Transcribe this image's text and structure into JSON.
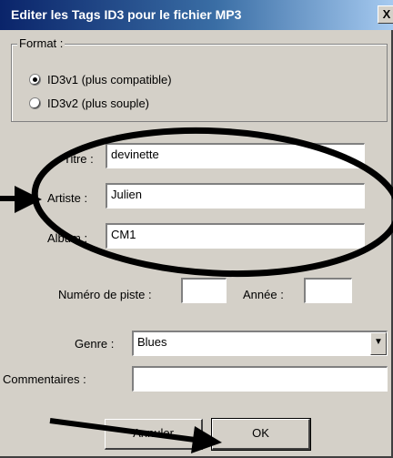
{
  "window": {
    "title": "Editer les Tags ID3 pour le fichier MP3",
    "close_glyph": "X"
  },
  "format": {
    "legend": "Format :",
    "options": [
      {
        "label": "ID3v1 (plus compatible)",
        "checked": true
      },
      {
        "label": "ID3v2 (plus souple)",
        "checked": false
      }
    ]
  },
  "fields": {
    "title": {
      "label": "Titre :",
      "value": "devinette"
    },
    "artist": {
      "label": "Artiste :",
      "value": "Julien"
    },
    "album": {
      "label": "Album :",
      "value": "CM1"
    },
    "track": {
      "label": "Numéro de piste :",
      "value": ""
    },
    "year": {
      "label": "Année :",
      "value": ""
    },
    "genre": {
      "label": "Genre :",
      "value": "Blues"
    },
    "comments": {
      "label": "Commentaires :",
      "value": ""
    }
  },
  "buttons": {
    "cancel": "Annuler",
    "ok": "OK"
  },
  "annotations": {
    "ellipse": "highlight-ellipse",
    "arrows": [
      "arrow-right-icon",
      "arrow-right-icon"
    ]
  }
}
